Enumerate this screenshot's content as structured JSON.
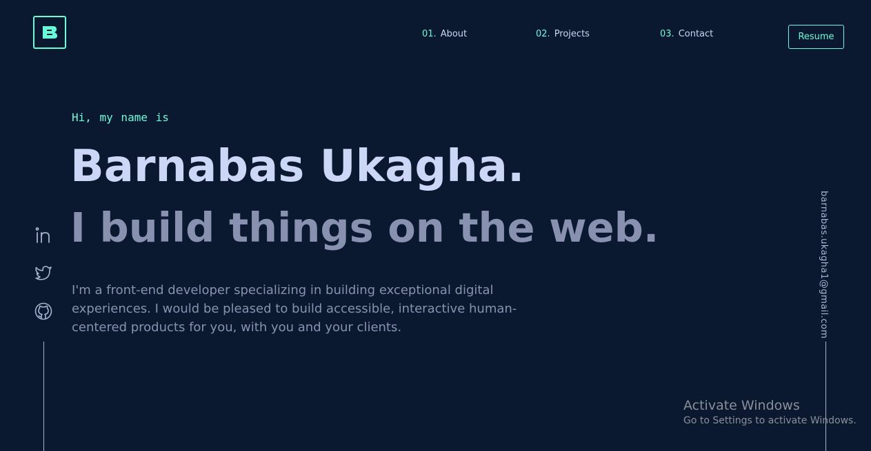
{
  "logo": {
    "letter": "B"
  },
  "nav": {
    "items": [
      {
        "num": "01.",
        "label": "About"
      },
      {
        "num": "02.",
        "label": "Projects"
      },
      {
        "num": "03.",
        "label": "Contact"
      }
    ],
    "resume_label": "Resume"
  },
  "hero": {
    "greeting": "Hi, my name is",
    "name": "Barnabas Ukagha.",
    "tagline": "I build things on the web.",
    "intro": "I'm a front-end developer specializing in building exceptional digital experiences. I would be pleased to build accessible, interactive human-centered products for you, with you and your clients."
  },
  "social": [
    "linkedin-icon",
    "twitter-icon",
    "github-icon"
  ],
  "email": "barnabas.ukagha1@gmail.com",
  "watermark": {
    "title": "Activate Windows",
    "subtitle": "Go to Settings to activate Windows."
  },
  "colors": {
    "background": "#0b1930",
    "accent": "#64ffda",
    "heading": "#ccd6f6",
    "body_text": "#8892b0"
  }
}
